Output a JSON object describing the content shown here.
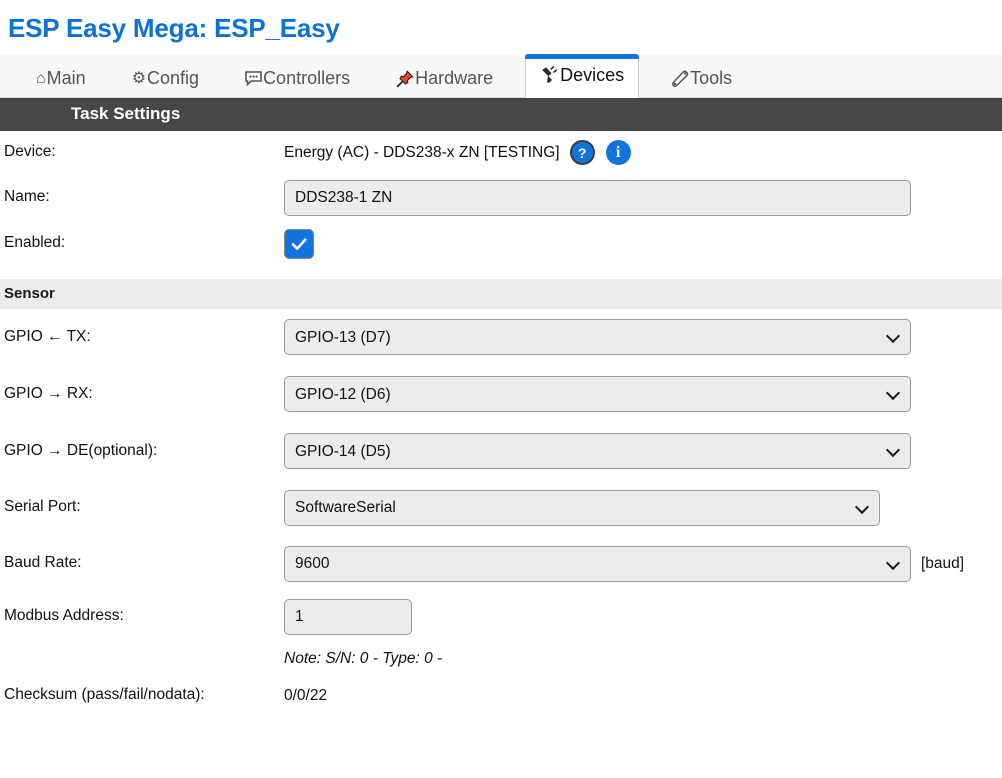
{
  "header": {
    "title": "ESP Easy Mega: ESP_Easy"
  },
  "tabs": [
    {
      "label": "Main",
      "icon": "home-icon",
      "glyph": "⌂",
      "active": false
    },
    {
      "label": "Config",
      "icon": "gear-icon",
      "glyph": "⚙",
      "active": false
    },
    {
      "label": "Controllers",
      "icon": "speech-balloon-icon",
      "glyph": "🗩",
      "active": false
    },
    {
      "label": "Hardware",
      "icon": "pushpin-icon",
      "glyph": "📌",
      "active": false
    },
    {
      "label": "Devices",
      "icon": "plug-icon",
      "glyph": "🔌",
      "active": true
    },
    {
      "label": "Tools",
      "icon": "wrench-icon",
      "glyph": "🔧",
      "active": false
    }
  ],
  "sections": {
    "task_settings": "Task Settings",
    "sensor": "Sensor"
  },
  "task": {
    "device_label": "Device:",
    "device_value": "Energy (AC) - DDS238-x ZN [TESTING]",
    "help_icon_label": "?",
    "info_icon_label": "i",
    "name_label": "Name:",
    "name_value": "DDS238-1 ZN",
    "enabled_label": "Enabled:",
    "enabled_checked": true
  },
  "sensor": {
    "gpio_tx_label": "GPIO ← TX:",
    "gpio_tx_value": "GPIO-13 (D7)",
    "gpio_rx_label": "GPIO → RX:",
    "gpio_rx_value": "GPIO-12 (D6)",
    "gpio_de_label": "GPIO → DE(optional):",
    "gpio_de_value": "GPIO-14 (D5)",
    "serial_port_label": "Serial Port:",
    "serial_port_value": "SoftwareSerial",
    "baud_rate_label": "Baud Rate:",
    "baud_rate_value": "9600",
    "baud_unit": "[baud]",
    "modbus_label": "Modbus Address:",
    "modbus_value": "1",
    "note": "Note: S/N: 0 - Type: 0 -",
    "checksum_label": "Checksum (pass/fail/nodata):",
    "checksum_value": "0/0/22"
  },
  "colors": {
    "title": "#0b72d9",
    "accent": "#1273de",
    "section_dark_bg": "#474747",
    "section_light_bg": "#ececec",
    "field_bg": "#ececec"
  }
}
